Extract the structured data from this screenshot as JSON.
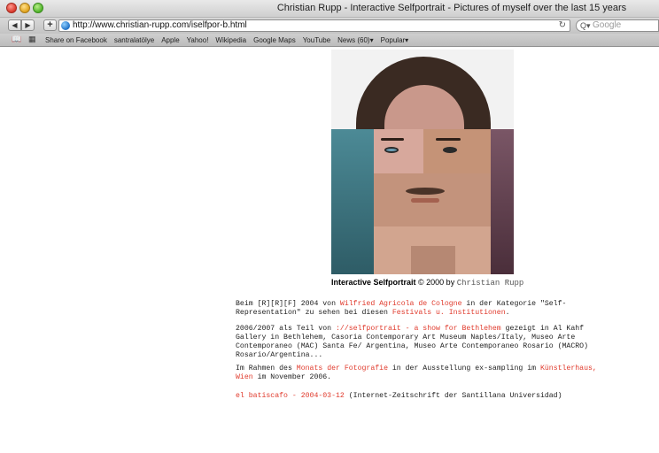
{
  "window": {
    "title": "Christian Rupp - Interactive Selfportrait - Pictures of myself over the last 15 years"
  },
  "toolbar": {
    "back_icon": "◀",
    "forward_icon": "▶",
    "add_icon": "+",
    "url": "http://www.christian-rupp.com/iselfpor-b.html",
    "reload_icon": "↻",
    "search_icon": "Q▾",
    "search_placeholder": "Google"
  },
  "bookmarks": {
    "book_icon": "📖",
    "grid_icon": "▦",
    "items": [
      "Share on Facebook",
      "santralatölye",
      "Apple",
      "Yahoo!",
      "Wikipedia",
      "Google Maps",
      "YouTube",
      "News (60)▾",
      "Popular▾"
    ]
  },
  "content": {
    "caption_title": "Interactive Selfportrait",
    "caption_year": " © 2000 by ",
    "caption_name": "Christian Rupp",
    "p1": {
      "t1": "Beim [R][R][F] 2004 von ",
      "l1": "Wilfried Agricola de Cologne",
      "t2": " in der Kategorie \"Self-Representation\" zu sehen bei diesen ",
      "l2": "Festivals u. Institutionen",
      "t3": "."
    },
    "p2": {
      "t1": "2006/2007 als Teil von ",
      "l1": "://selfportrait - a show for Bethlehem",
      "t2": " gezeigt in Al Kahf Gallery in Bethlehem, Casoria Contemporary Art Museum Naples/Italy, Museo Arte Contemporaneo (MAC) Santa Fe/ Argentina, Museo Arte Contemporaneo Rosario (MACRO) Rosario/Argentina..."
    },
    "p3": {
      "t1": "Im Rahmen des ",
      "l1": "Monats der Fotografie",
      "t2": " in der Ausstellung ex-sampling im ",
      "l2": "Künstlerhaus, Wien",
      "t3": " im November 2006."
    },
    "p4": {
      "l1": "el batiscafo - 2004-03-12",
      "t1": " (Internet-Zeitschrift der Santillana Universidad)"
    }
  },
  "colors": {
    "link": "#e03a2c",
    "text": "#222222"
  }
}
